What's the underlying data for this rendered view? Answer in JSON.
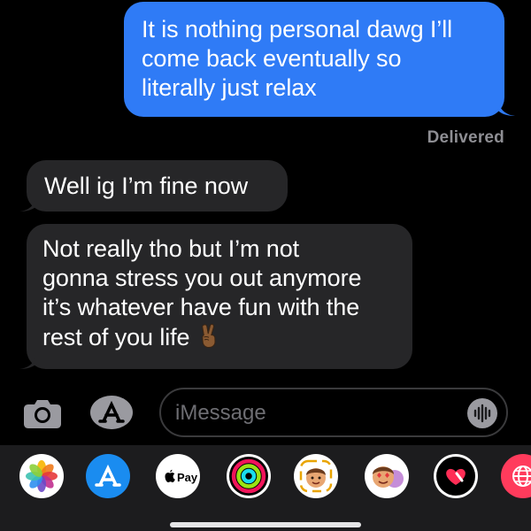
{
  "thread": {
    "outgoing": [
      {
        "lines": [
          "It is nothing personal dawg I’ll",
          "come back eventually so",
          "literally just relax"
        ]
      }
    ],
    "receipt": "Delivered",
    "incoming": [
      {
        "lines": [
          "Well ig I’m fine now"
        ]
      },
      {
        "lines": [
          "Not really tho but I’m not",
          "gonna stress you out anymore",
          "it’s whatever have fun with the",
          "rest of you life"
        ],
        "emoji": "victory-hand-medium-dark-skin"
      }
    ]
  },
  "input_bar": {
    "placeholder": "iMessage",
    "camera_icon": "camera-icon",
    "apps_icon": "app-store-icon",
    "audio_icon": "audio-waveform-icon"
  },
  "app_strip": {
    "apps": [
      {
        "name": "photos-app-icon"
      },
      {
        "name": "app-store-app-icon"
      },
      {
        "name": "apple-pay-app-icon",
        "label": "Pay"
      },
      {
        "name": "fitness-activity-app-icon"
      },
      {
        "name": "memoji-stickers-app-icon"
      },
      {
        "name": "animoji-app-icon"
      },
      {
        "name": "digital-touch-app-icon"
      },
      {
        "name": "web-search-app-icon"
      }
    ]
  },
  "colors": {
    "outgoing_bubble": "#2f7bf6",
    "incoming_bubble": "#262628",
    "background": "#000000",
    "receipt_text": "#8e8e93"
  }
}
